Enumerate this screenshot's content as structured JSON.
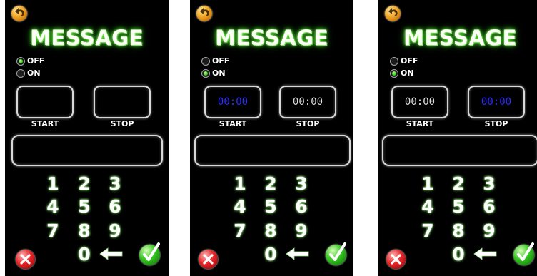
{
  "screens": [
    {
      "title": "MESSAGE",
      "radio": {
        "off_label": "OFF",
        "on_label": "ON",
        "selected": "OFF"
      },
      "start": {
        "value": "",
        "label": "START",
        "active": false
      },
      "stop": {
        "value": "",
        "label": "STOP",
        "active": false
      },
      "message_value": "",
      "keypad": [
        "1",
        "2",
        "3",
        "4",
        "5",
        "6",
        "7",
        "8",
        "9",
        "0"
      ]
    },
    {
      "title": "MESSAGE",
      "radio": {
        "off_label": "OFF",
        "on_label": "ON",
        "selected": "ON"
      },
      "start": {
        "value": "00:00",
        "label": "START",
        "active": true
      },
      "stop": {
        "value": "00:00",
        "label": "STOP",
        "active": false
      },
      "message_value": "",
      "keypad": [
        "1",
        "2",
        "3",
        "4",
        "5",
        "6",
        "7",
        "8",
        "9",
        "0"
      ]
    },
    {
      "title": "MESSAGE",
      "radio": {
        "off_label": "OFF",
        "on_label": "ON",
        "selected": "ON"
      },
      "start": {
        "value": "00:00",
        "label": "START",
        "active": false
      },
      "stop": {
        "value": "00:00",
        "label": "STOP",
        "active": true
      },
      "message_value": "",
      "keypad": [
        "1",
        "2",
        "3",
        "4",
        "5",
        "6",
        "7",
        "8",
        "9",
        "0"
      ]
    }
  ],
  "icons": {
    "back": "back-arrow-icon",
    "cancel": "cancel-x-icon",
    "confirm": "checkmark-icon",
    "backspace": "backspace-arrow-icon"
  },
  "colors": {
    "screen_bg": "#000000",
    "active_time_text": "#2d2dff",
    "idle_time_text": "#dcdcdc",
    "title_glow": "#3fbf2a",
    "radio_selected": "#3bd11f"
  }
}
